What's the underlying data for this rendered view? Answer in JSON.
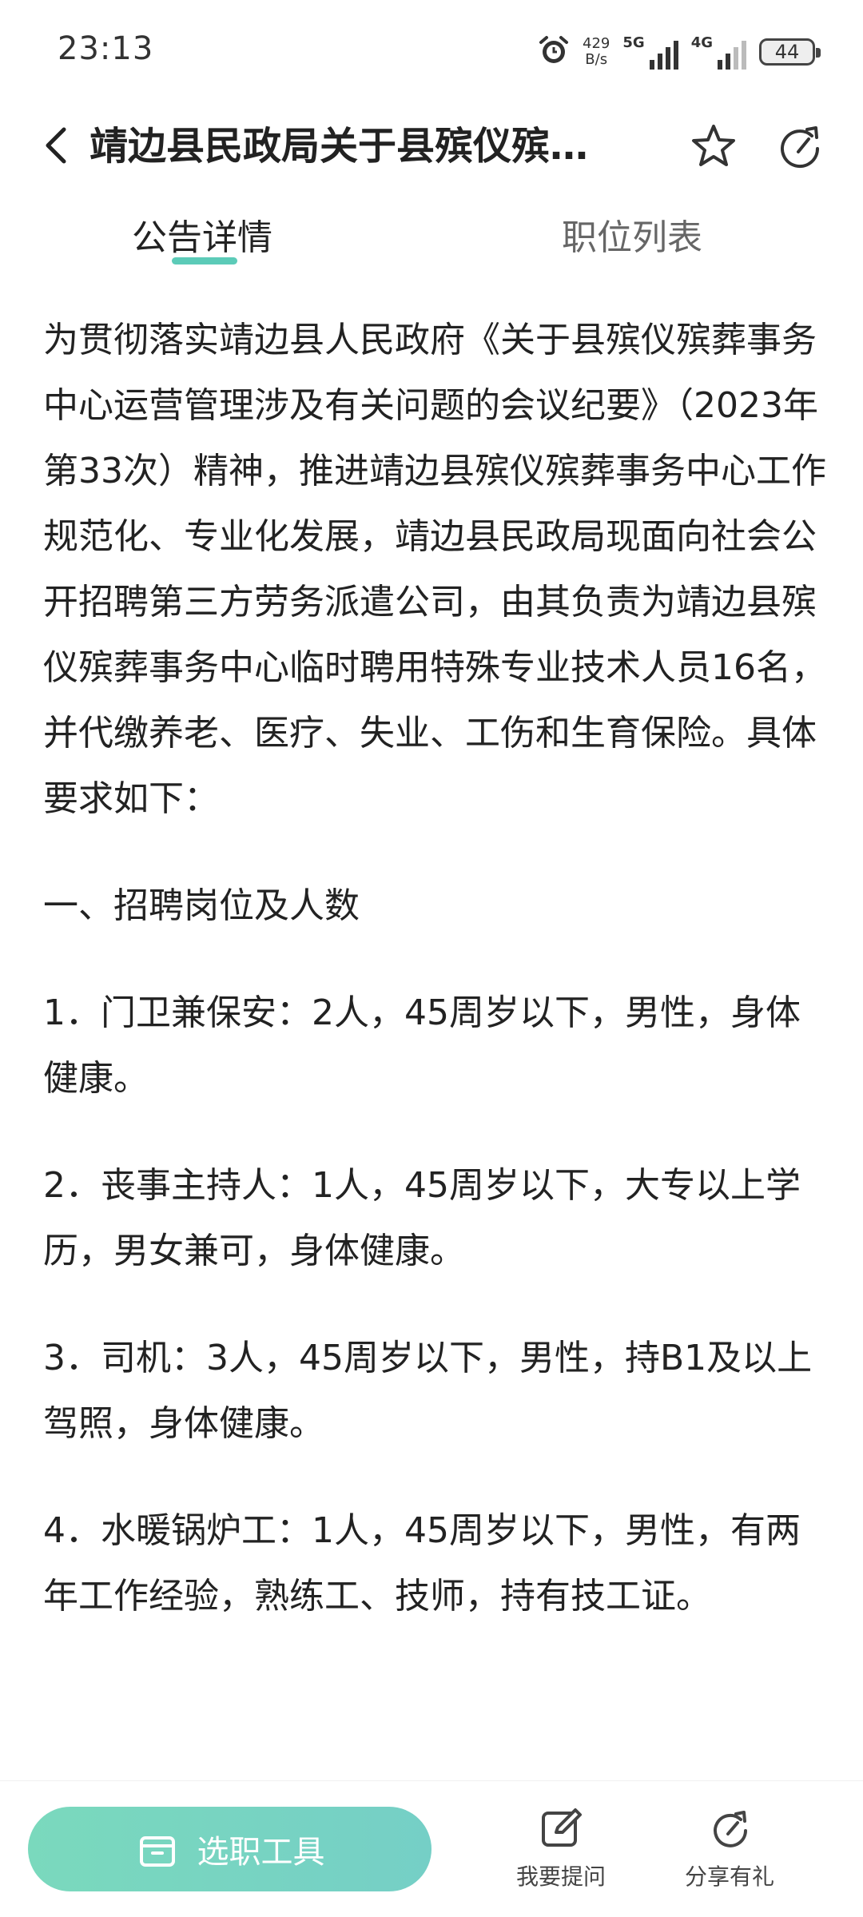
{
  "status_bar": {
    "time": "23:13",
    "net_speed_value": "429",
    "net_speed_unit": "B/s",
    "signal1_label": "5G",
    "signal2_label": "4G",
    "battery": "44"
  },
  "header": {
    "title": "靖边县民政局关于县殡仪殡…"
  },
  "tabs": [
    {
      "label": "公告详情",
      "active": true
    },
    {
      "label": "职位列表",
      "active": false
    }
  ],
  "content": {
    "paragraphs": [
      "为贯彻落实靖边县人民政府《关于县殡仪殡葬事务中心运营管理涉及有关问题的会议纪要》（2023年第33次）精神，推进靖边县殡仪殡葬事务中心工作规范化、专业化发展，靖边县民政局现面向社会公开招聘第三方劳务派遣公司，由其负责为靖边县殡仪殡葬事务中心临时聘用特殊专业技术人员16名，并代缴养老、医疗、失业、工伤和生育保险。具体要求如下：",
      "一、招聘岗位及人数",
      "1．门卫兼保安：2人，45周岁以下，男性，身体健康。",
      "2．丧事主持人：1人，45周岁以下，大专以上学历，男女兼可，身体健康。",
      "3．司机：3人，45周岁以下，男性，持B1及以上驾照，身体健康。",
      "4．水暖锅炉工：1人，45周岁以下，男性，有两年工作经验，熟练工、技师，持有技工证。"
    ]
  },
  "bottom_bar": {
    "tool_button": "选职工具",
    "ask_label": "我要提问",
    "share_label": "分享有礼"
  },
  "colors": {
    "accent": "#5ccbb8",
    "button_gradient_start": "#7ad9bd",
    "button_gradient_end": "#75cfc6"
  }
}
